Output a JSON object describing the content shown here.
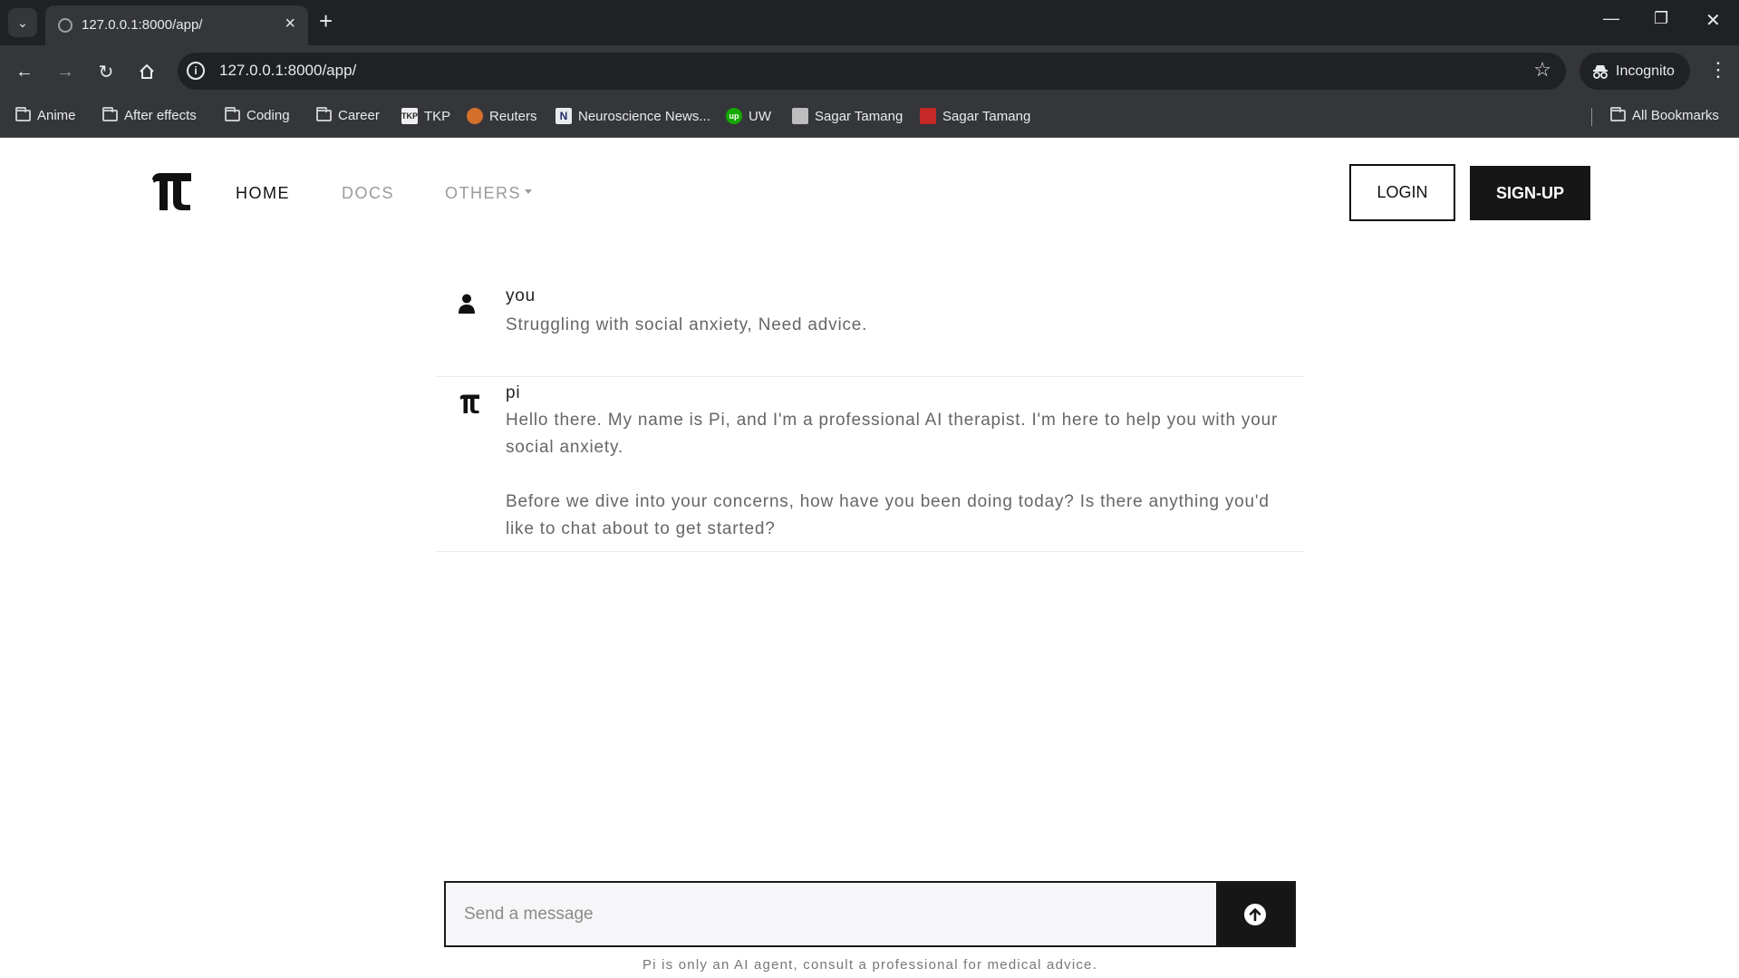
{
  "browser": {
    "tab_title": "127.0.0.1:8000/app/",
    "url": "127.0.0.1:8000/app/",
    "profile_label": "Incognito",
    "bookmarks": [
      {
        "label": "Anime",
        "icon": "folder-icon"
      },
      {
        "label": "After effects",
        "icon": "folder-icon"
      },
      {
        "label": "Coding",
        "icon": "folder-icon"
      },
      {
        "label": "Career",
        "icon": "folder-icon"
      },
      {
        "label": "TKP",
        "icon": "tkp-favicon"
      },
      {
        "label": "Reuters",
        "icon": "reuters-favicon"
      },
      {
        "label": "Neuroscience News...",
        "icon": "neuroscience-news-favicon"
      },
      {
        "label": "UW",
        "icon": "upwork-favicon"
      },
      {
        "label": "Sagar Tamang",
        "icon": "profile-favicon"
      },
      {
        "label": "Sagar Tamang",
        "icon": "profile-favicon"
      }
    ],
    "all_bookmarks_label": "All Bookmarks"
  },
  "app": {
    "nav": {
      "home": "HOME",
      "docs": "DOCS",
      "others": "OTHERS"
    },
    "login_label": "LOGIN",
    "signup_label": "SIGN-UP",
    "messages": [
      {
        "author": "you",
        "paragraphs": [
          "Struggling with social anxiety, Need advice."
        ]
      },
      {
        "author": "pi",
        "paragraphs": [
          "Hello there. My name is Pi, and I'm a professional AI therapist. I'm here to help you with your social anxiety.",
          "Before we dive into your concerns, how have you been doing today? Is there anything you'd like to chat about to get started?"
        ]
      }
    ],
    "composer": {
      "placeholder": "Send a message",
      "value": ""
    },
    "disclaimer": "Pi is only an AI agent, consult a professional for medical advice."
  }
}
